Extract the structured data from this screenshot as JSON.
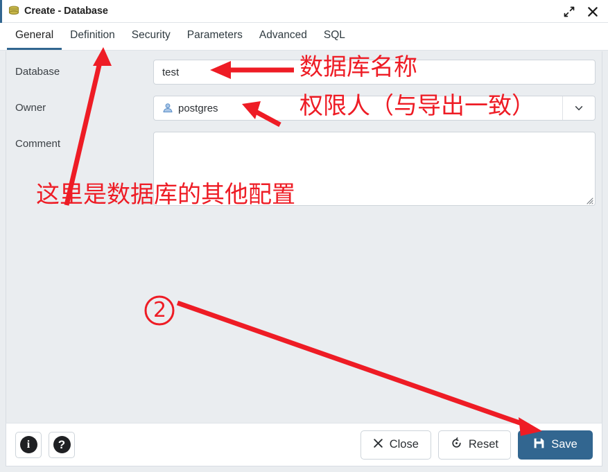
{
  "window": {
    "title": "Create - Database",
    "icon": "database-icon",
    "maximize_label": "Maximize",
    "close_label": "Close"
  },
  "tabs": [
    {
      "label": "General",
      "active": true
    },
    {
      "label": "Definition",
      "active": false
    },
    {
      "label": "Security",
      "active": false
    },
    {
      "label": "Parameters",
      "active": false
    },
    {
      "label": "Advanced",
      "active": false
    },
    {
      "label": "SQL",
      "active": false
    }
  ],
  "form": {
    "database": {
      "label": "Database",
      "value": "test",
      "placeholder": ""
    },
    "owner": {
      "label": "Owner",
      "value": "postgres",
      "icon": "person-icon",
      "placeholder": ""
    },
    "comment": {
      "label": "Comment",
      "value": "",
      "placeholder": ""
    }
  },
  "footer": {
    "info_label": "i",
    "help_label": "?",
    "close_label": "Close",
    "reset_label": "Reset",
    "save_label": "Save"
  },
  "annotations": {
    "database_name": "数据库名称",
    "owner_note": "权限人（与导出一致）",
    "other_config": "这里是数据库的其他配置",
    "step_marker": "2"
  },
  "colors": {
    "accent": "#326690",
    "annotation": "#ee1c25",
    "panel_bg": "#eaedf0",
    "surface": "#ffffff",
    "border": "#ced4da",
    "db_icon": "#b5a642",
    "person_icon": "#7ea6d8"
  }
}
